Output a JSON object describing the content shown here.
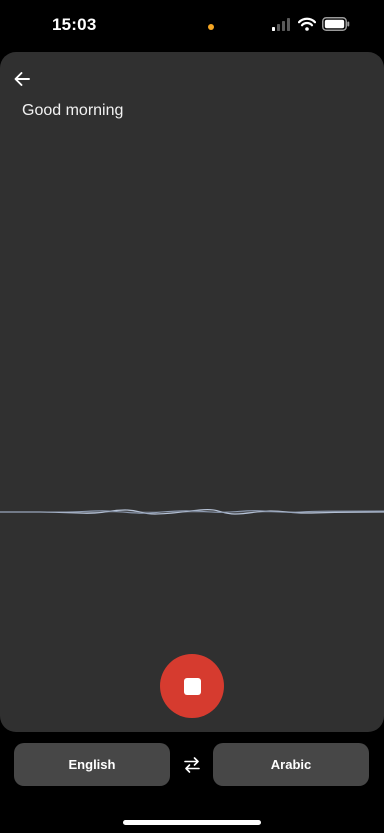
{
  "status_bar": {
    "time": "15:03",
    "privacy_dot_color": "#f5a623",
    "icons": [
      "signal-icon",
      "wifi-icon",
      "battery-icon"
    ]
  },
  "transcript": {
    "text": "Good morning"
  },
  "controls": {
    "back_icon": "arrow-left-icon",
    "stop_icon": "stop-icon",
    "stop_color": "#d63b2f",
    "swap_icon": "swap-icon"
  },
  "languages": {
    "source": "English",
    "target": "Arabic"
  }
}
